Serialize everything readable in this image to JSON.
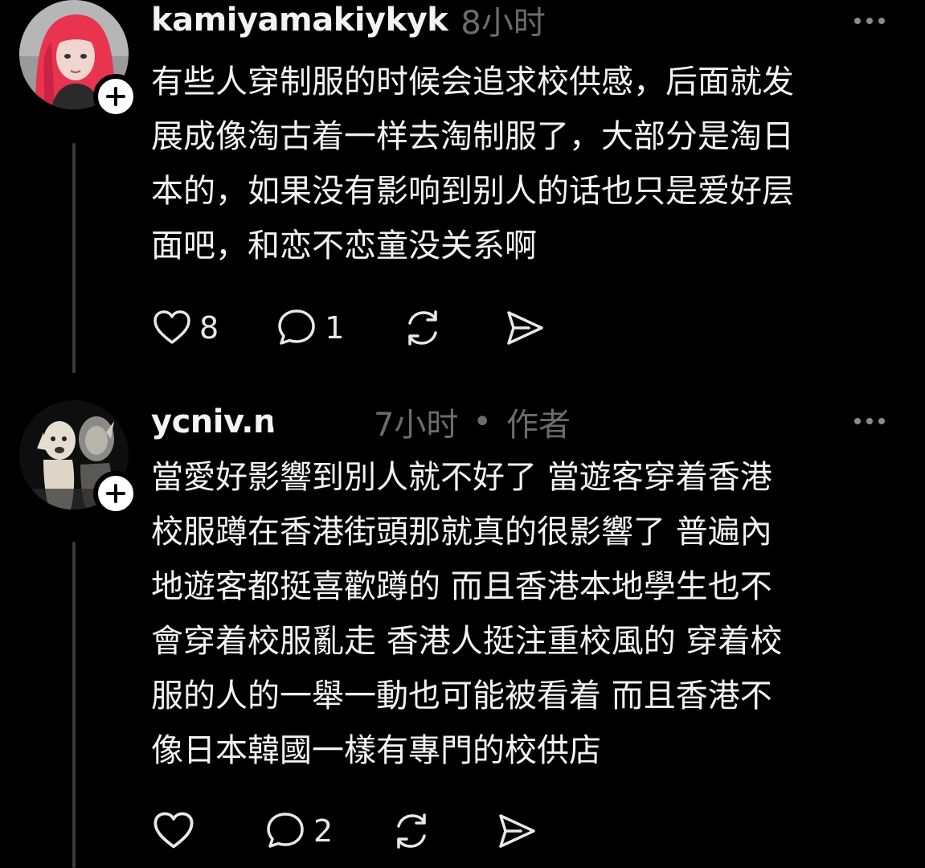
{
  "posts": [
    {
      "username": "kamiyamakiykyk",
      "time": "8小时",
      "lines": [
        "有些人穿制服的时候会追求校供感，后面就发",
        "展成像淘古着一样去淘制服了，大部分是淘日",
        "本的，如果没有影响到别人的话也只是爱好层",
        "面吧，和恋不恋童没关系啊"
      ],
      "likes": "8",
      "comments": "1"
    },
    {
      "username": "ycniv.n",
      "time": "7小时",
      "dot": "•",
      "role": "作者",
      "lines": [
        "當愛好影響到別人就不好了 當遊客穿着香港",
        "校服蹲在香港街頭那就真的很影響了 普遍內",
        "地遊客都挺喜歡蹲的 而且香港本地學生也不",
        "會穿着校服亂走 香港人挺注重校風的 穿着校",
        "服的人的一舉一動也可能被看着 而且香港不",
        "像日本韓國一樣有專門的校供店"
      ],
      "likes": "",
      "comments": "2"
    }
  ],
  "icons": [
    "plus-icon",
    "more-icon",
    "heart-icon",
    "comment-icon",
    "repost-icon",
    "share-icon"
  ],
  "colors": {
    "background": "#000000",
    "text": "#f3f3f3",
    "muted": "#6c6c6c",
    "thread_line": "#3a3a3a",
    "avatar_hair": "#e8344f"
  }
}
